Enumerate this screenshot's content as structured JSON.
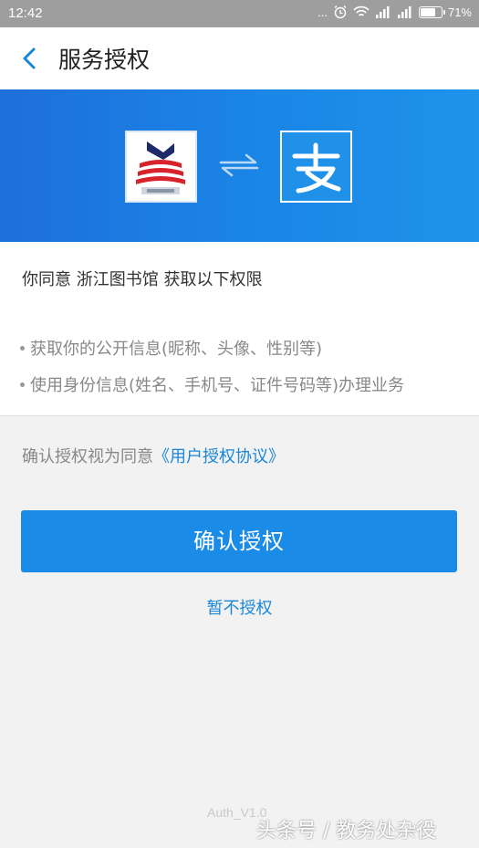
{
  "status_bar": {
    "time": "12:42",
    "dots": "...",
    "battery_text": "71%",
    "battery_level": 0.71
  },
  "nav": {
    "title": "服务授权",
    "back_icon": "chevron-left-icon"
  },
  "banner": {
    "app_logo_text": "浙图",
    "swap_icon": "swap-arrows-icon",
    "alipay_glyph": "支"
  },
  "permissions": {
    "heading": "你同意 浙江图书馆 获取以下权限",
    "items": [
      "获取你的公开信息(昵称、头像、性别等)",
      "使用身份信息(姓名、手机号、证件号码等)办理业务"
    ]
  },
  "agreement": {
    "prefix": "确认授权视为同意",
    "link": "《用户授权协议》"
  },
  "actions": {
    "confirm": "确认授权",
    "decline": "暂不授权"
  },
  "footer": {
    "version": "Auth_V1.0",
    "watermark": "头条号 / 教务处杂役"
  },
  "colors": {
    "accent": "#1a8be6",
    "link": "#1a86d8",
    "status_bar": "#9e9e9e"
  }
}
